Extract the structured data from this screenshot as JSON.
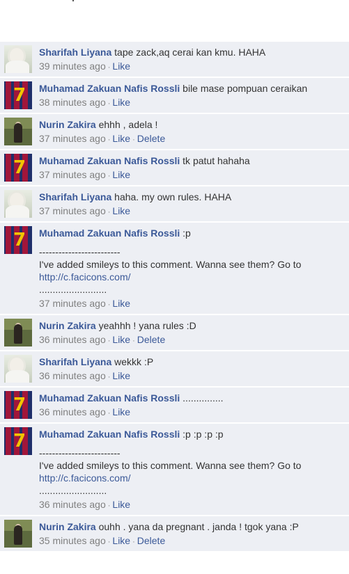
{
  "comments": [
    {
      "author": "Sharifah Liyana",
      "avatar": "shar",
      "text": "tape zack,aq cerai kan kmu. HAHA",
      "time": "39 minutes ago",
      "actions": [
        "Like"
      ]
    },
    {
      "author": "Muhamad Zakuan Nafis Rossli",
      "avatar": "muh",
      "text": "bile mase pompuan ceraikan",
      "time": "38 minutes ago",
      "actions": [
        "Like"
      ]
    },
    {
      "author": "Nurin Zakira",
      "avatar": "nur",
      "text": "ehhh , adela !",
      "time": "37 minutes ago",
      "actions": [
        "Like",
        "Delete"
      ]
    },
    {
      "author": "Muhamad Zakuan Nafis Rossli",
      "avatar": "muh",
      "text": "tk patut hahaha",
      "time": "37 minutes ago",
      "actions": [
        "Like"
      ]
    },
    {
      "author": "Sharifah Liyana",
      "avatar": "shar",
      "text": "haha. my own rules. HAHA",
      "time": "37 minutes ago",
      "actions": [
        "Like"
      ]
    },
    {
      "author": "Muhamad Zakuan Nafis Rossli",
      "avatar": "muh",
      "text": ":p",
      "time": "37 minutes ago",
      "actions": [
        "Like"
      ],
      "extra": {
        "dashes": "-------------------------",
        "message": "I've added smileys to this comment. Wanna see them? Go to",
        "link": "http://c.facicons.com/",
        "dots": "........................."
      }
    },
    {
      "author": "Nurin Zakira",
      "avatar": "nur",
      "text": "yeahhh ! yana rules :D",
      "time": "36 minutes ago",
      "actions": [
        "Like",
        "Delete"
      ]
    },
    {
      "author": "Sharifah Liyana",
      "avatar": "shar",
      "text": "wekkk :P",
      "time": "36 minutes ago",
      "actions": [
        "Like"
      ]
    },
    {
      "author": "Muhamad Zakuan Nafis Rossli",
      "avatar": "muh",
      "text": "...............",
      "time": "36 minutes ago",
      "actions": [
        "Like"
      ]
    },
    {
      "author": "Muhamad Zakuan Nafis Rossli",
      "avatar": "muh",
      "text": ":p :p :p :p",
      "time": "36 minutes ago",
      "actions": [
        "Like"
      ],
      "extra": {
        "dashes": "-------------------------",
        "message": "I've added smileys to this comment. Wanna see them? Go to",
        "link": "http://c.facicons.com/",
        "dots": "........................."
      }
    },
    {
      "author": "Nurin Zakira",
      "avatar": "nur",
      "text": "ouhh . yana da pregnant . janda ! tgok yana :P",
      "time": "35 minutes ago",
      "actions": [
        "Like",
        "Delete"
      ]
    }
  ],
  "avatar_colors": {
    "muh_jersey_blue": "#1f2f6a",
    "muh_jersey_red": "#a1163a",
    "muh_number": "#f2c400"
  },
  "avatar_number": "7",
  "colors": {
    "link": "#3b5998",
    "row_bg": "#edeff4",
    "meta": "#808080"
  }
}
